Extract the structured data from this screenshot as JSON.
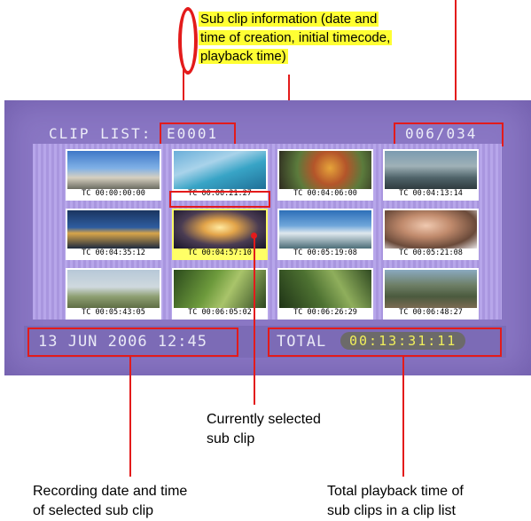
{
  "callout_top": {
    "line1": "Sub clip information (date and",
    "line2": "time of creation, initial timecode,",
    "line3": "playback time)"
  },
  "screen": {
    "clip_list_label": "CLIP LIST:",
    "clip_id": "E0001",
    "clip_counter": "006/034",
    "thumbnails": [
      {
        "tc": "TC 00:00:00:00",
        "scene": "sky-building"
      },
      {
        "tc": "TC 00:00:21:27",
        "scene": "pool"
      },
      {
        "tc": "TC 00:04:06:00",
        "scene": "flowers"
      },
      {
        "tc": "TC 00:04:13:14",
        "scene": "harbor"
      },
      {
        "tc": "TC 00:04:35:12",
        "scene": "night-city"
      },
      {
        "tc": "TC 00:04:57:10",
        "scene": "lamp"
      },
      {
        "tc": "TC 00:05:19:08",
        "scene": "stadium"
      },
      {
        "tc": "TC 00:05:21:08",
        "scene": "portrait"
      },
      {
        "tc": "TC 00:05:43:05",
        "scene": "field"
      },
      {
        "tc": "TC 00:06:05:02",
        "scene": "forest"
      },
      {
        "tc": "TC 00:06:26:29",
        "scene": "jungle"
      },
      {
        "tc": "TC 00:06:48:27",
        "scene": "cliff"
      }
    ],
    "selected_index": 5,
    "recording_datetime": "13 JUN 2006 12:45",
    "total_label": "TOTAL",
    "total_time": "00:13:31:11"
  },
  "labels": {
    "selected_line1": "Currently selected",
    "selected_line2": "sub clip",
    "recording_line1": "Recording date and time",
    "recording_line2": "of selected sub clip",
    "total_line1": "Total playback time of",
    "total_line2": "sub clips in a clip list"
  },
  "colors": {
    "callout_highlight": "#ffff33",
    "annotation_red": "#e31b1b",
    "screen_purple": "#8a77c4",
    "timecode_yellow": "#f2f05a"
  }
}
